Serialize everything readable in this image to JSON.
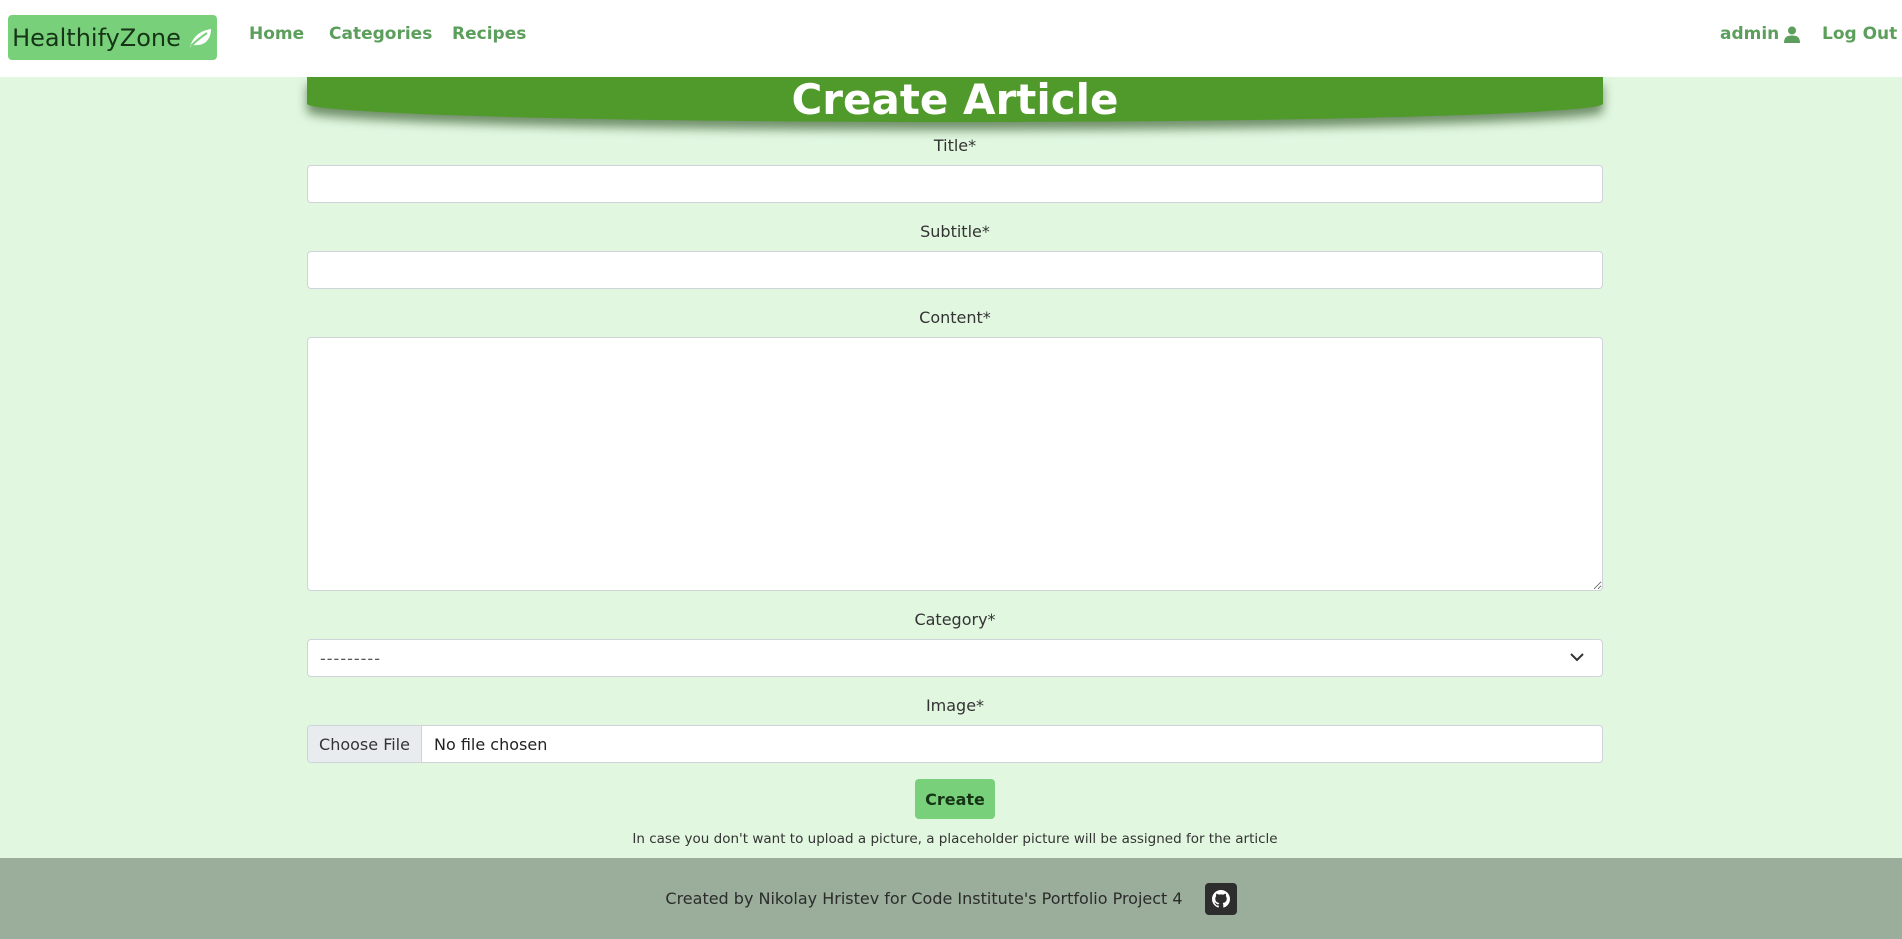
{
  "navbar": {
    "brand": "HealthifyZone",
    "brand_icon": "leaf-icon",
    "links": {
      "home": "Home",
      "categories": "Categories",
      "recipes": "Recipes"
    },
    "user": "admin",
    "user_icon": "user-icon",
    "logout": "Log Out",
    "link_color": "#5c9e5b",
    "brand_bg": "#78d17a"
  },
  "page": {
    "title": "Create Article",
    "banner_color": "#4f9a2b",
    "background": "#e1f7e0"
  },
  "form": {
    "title_label": "Title*",
    "subtitle_label": "Subtitle*",
    "content_label": "Content*",
    "category_label": "Category*",
    "category_selected": "---------",
    "image_label": "Image*",
    "file_button": "Choose File",
    "file_status": "No file chosen",
    "submit": "Create",
    "hint": "In case you don't want to upload a picture, a placeholder picture will be assigned for the article"
  },
  "footer": {
    "text": "Created by Nikolay Hristev for Code Institute's Portfolio Project 4",
    "icon": "github-icon",
    "background": "#9aae9b"
  }
}
